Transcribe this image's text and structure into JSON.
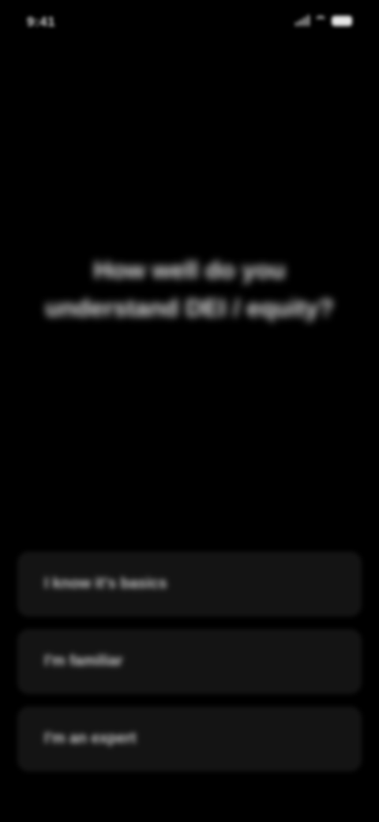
{
  "status_bar": {
    "time": "9:41"
  },
  "question": {
    "text": "How well do you understand DEI / equity?"
  },
  "answers": [
    {
      "label": "I know it's basics"
    },
    {
      "label": "I'm familiar"
    },
    {
      "label": "I'm an expert"
    }
  ]
}
